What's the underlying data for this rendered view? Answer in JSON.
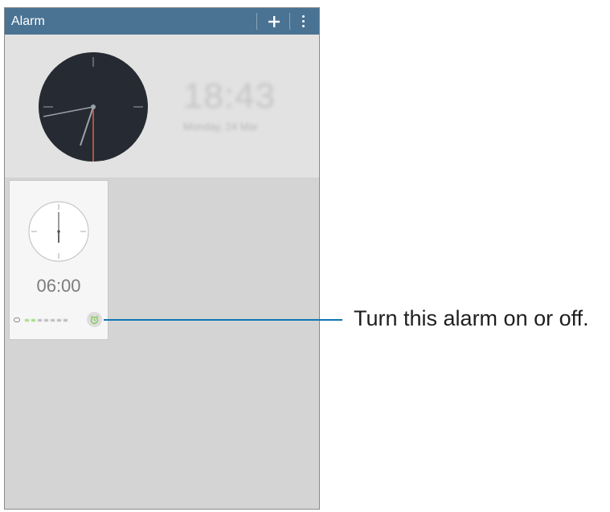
{
  "titlebar": {
    "title": "Alarm",
    "add_icon": "plus-icon",
    "more_icon": "more-vertical-icon",
    "color": "#4a7393"
  },
  "world_clock": {
    "time": "18:43",
    "date": "Monday, 24 Mar"
  },
  "alarm": {
    "time": "06:00",
    "repeat_icon": "repeat-icon",
    "toggle_icon": "alarm-clock-icon",
    "active_color": "#7ac943"
  },
  "callout": {
    "text": "Turn this alarm on or off.",
    "color": "#0f77b4"
  }
}
